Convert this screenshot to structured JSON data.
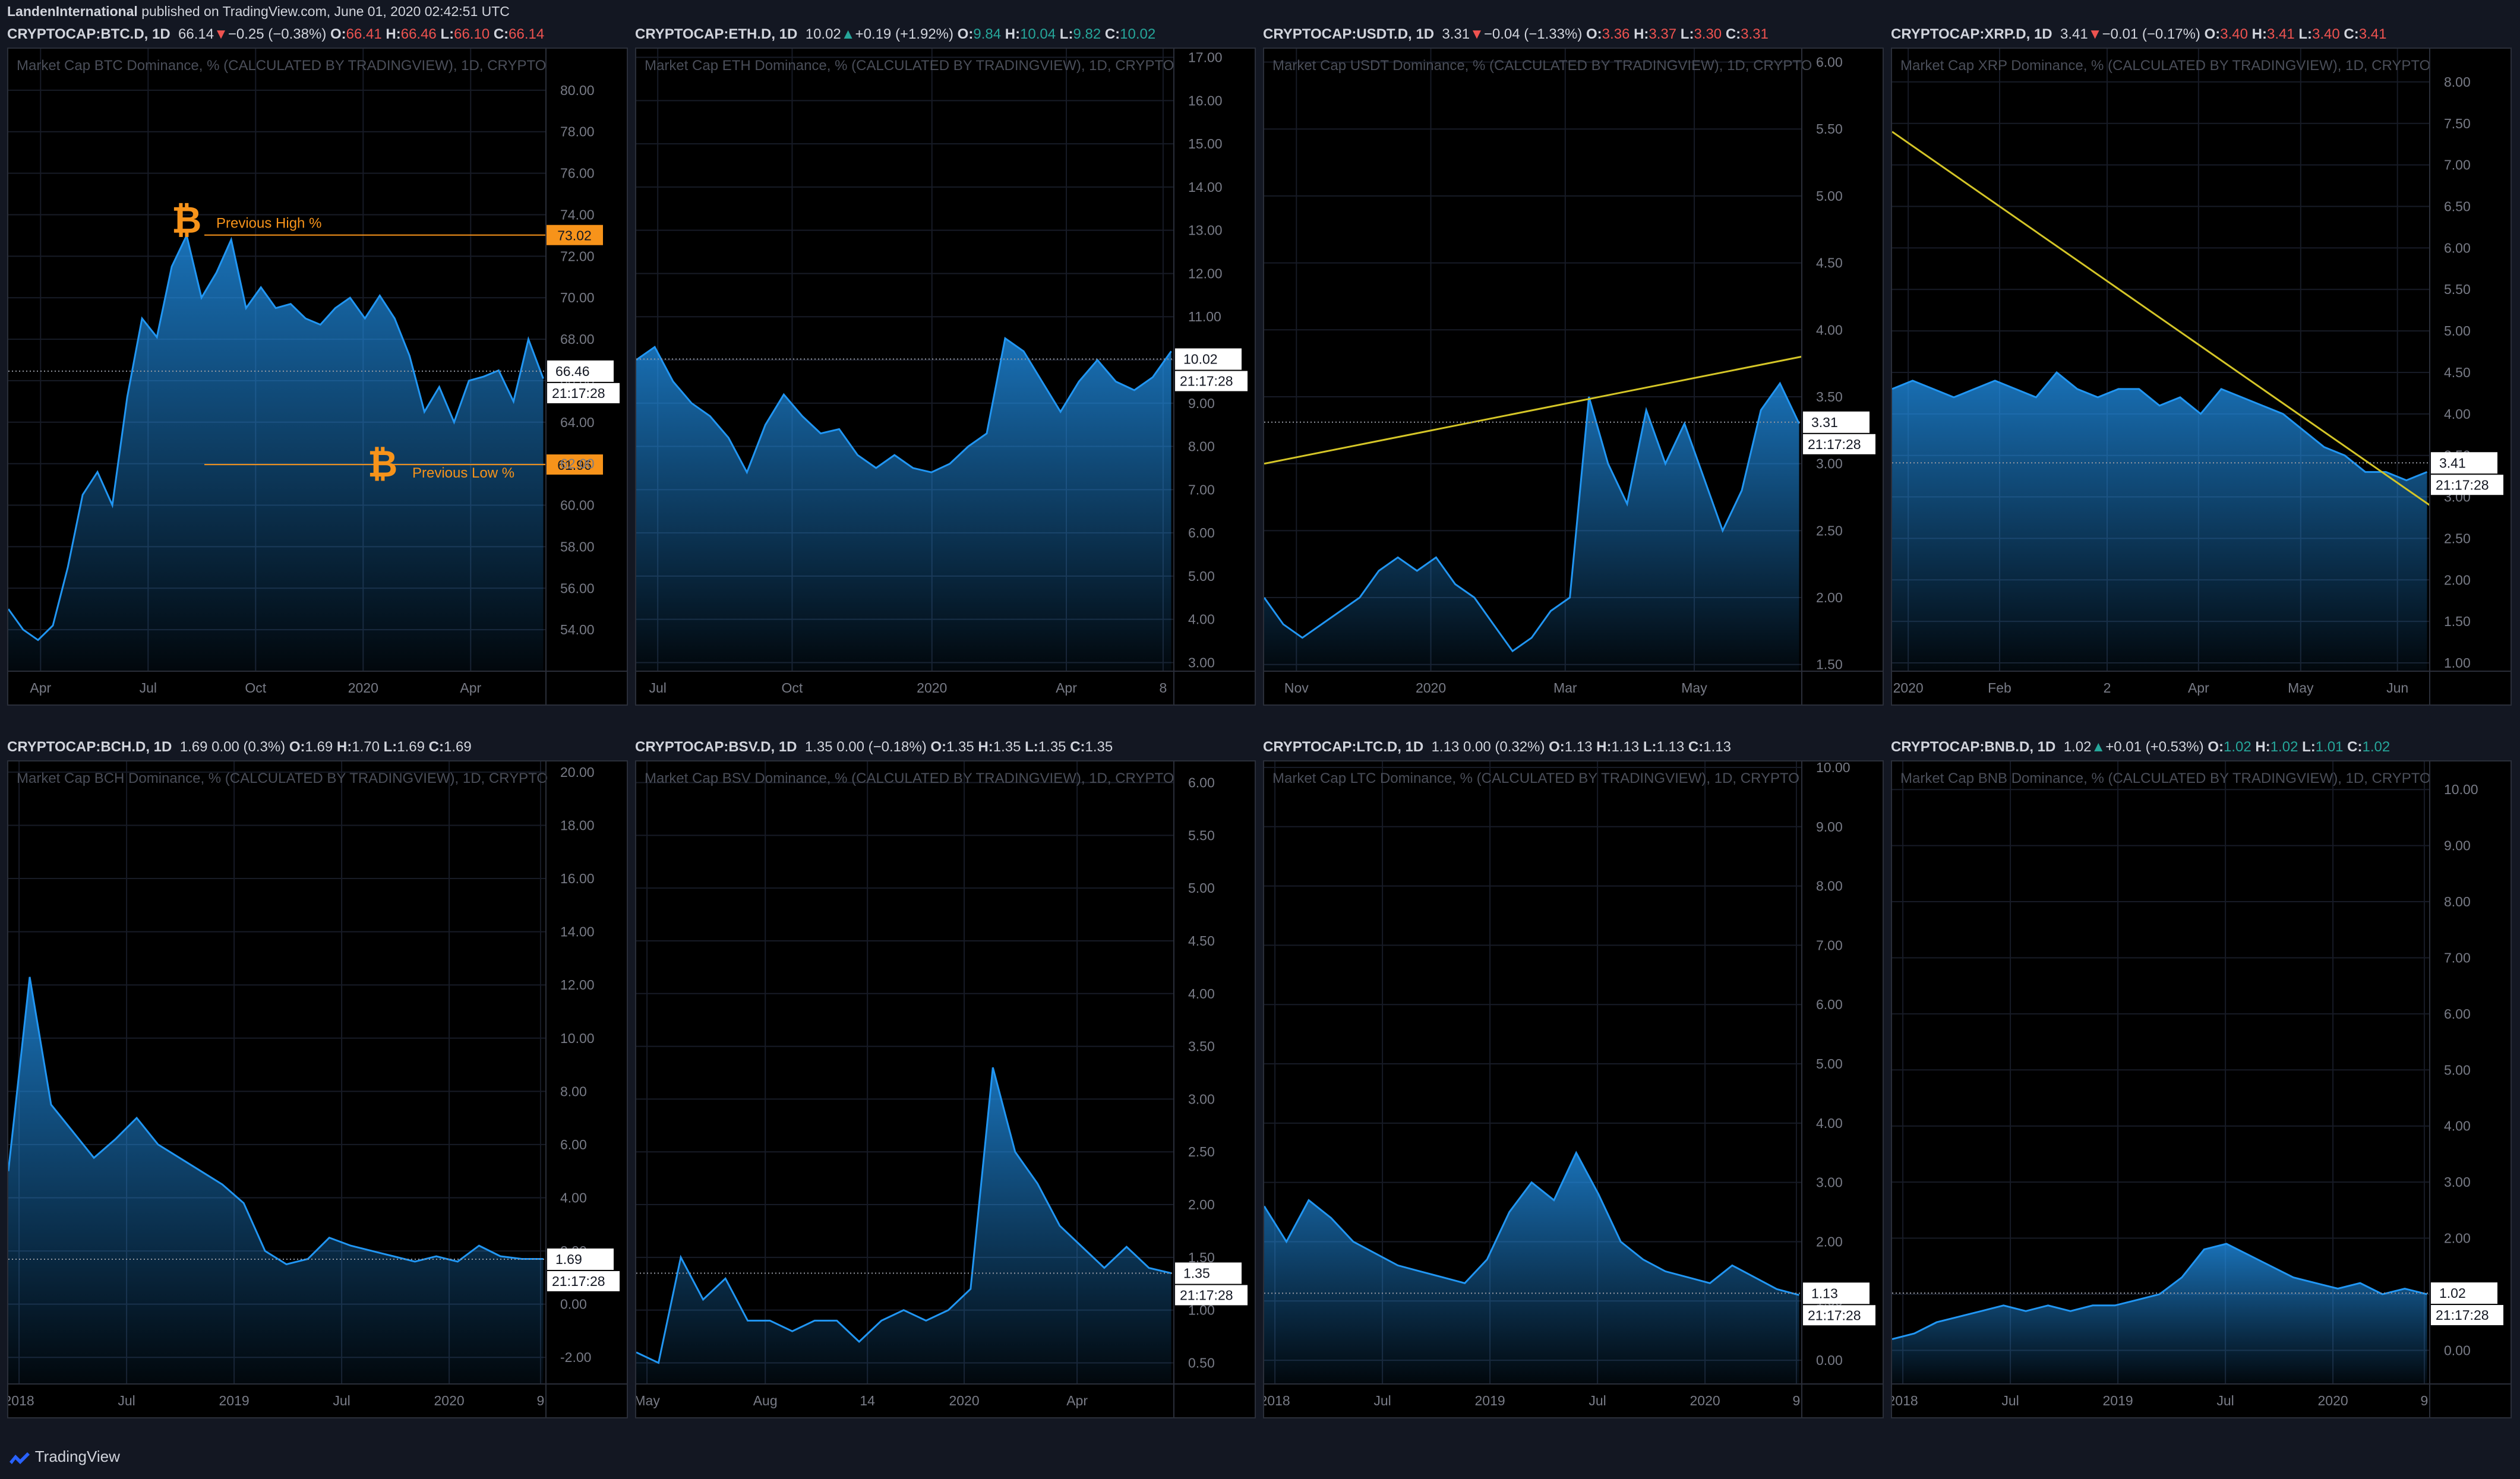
{
  "header": {
    "author": "LandenInternational",
    "published": "published on TradingView.com, June 01, 2020 02:42:51 UTC"
  },
  "brand": {
    "label": "TradingView",
    "accent": "#2962ff"
  },
  "countdown": "21:17:28",
  "colors": {
    "bg": "#131722",
    "chart_bg": "#000000",
    "line": "#2196f3",
    "axis_text": "#787b86",
    "down": "#ef5350",
    "up": "#26a69a",
    "trend": "#d4c527",
    "btc_marker": "#f7931a"
  },
  "panels": [
    {
      "symbol": "CRYPTOCAP:BTC.D, 1D",
      "last": "66.14",
      "dir": "down",
      "change": "−0.25 (−0.38%)",
      "O": "66.41",
      "H": "66.46",
      "L": "66.10",
      "C": "66.14",
      "ohlc_dir": "down",
      "watermark": "Market Cap BTC Dominance, % (CALCULATED BY TRADINGVIEW), 1D, CRYPTO",
      "price_label": "66.46"
    },
    {
      "symbol": "CRYPTOCAP:ETH.D, 1D",
      "last": "10.02",
      "dir": "up",
      "change": "+0.19 (+1.92%)",
      "O": "9.84",
      "H": "10.04",
      "L": "9.82",
      "C": "10.02",
      "ohlc_dir": "up",
      "watermark": "Market Cap ETH Dominance, % (CALCULATED BY TRADINGVIEW), 1D, CRYPTO",
      "price_label": "10.02"
    },
    {
      "symbol": "CRYPTOCAP:USDT.D, 1D",
      "last": "3.31",
      "dir": "down",
      "change": "−0.04 (−1.33%)",
      "O": "3.36",
      "H": "3.37",
      "L": "3.30",
      "C": "3.31",
      "ohlc_dir": "down",
      "watermark": "Market Cap USDT Dominance, % (CALCULATED BY TRADINGVIEW), 1D, CRYPTO",
      "price_label": "3.31"
    },
    {
      "symbol": "CRYPTOCAP:XRP.D, 1D",
      "last": "3.41",
      "dir": "down",
      "change": "−0.01 (−0.17%)",
      "O": "3.40",
      "H": "3.41",
      "L": "3.40",
      "C": "3.41",
      "ohlc_dir": "down",
      "watermark": "Market Cap XRP Dominance, % (CALCULATED BY TRADINGVIEW), 1D, CRYPTO",
      "price_label": "3.41"
    },
    {
      "symbol": "CRYPTOCAP:BCH.D, 1D",
      "last": "1.69",
      "dir": "none",
      "change": "0.00 (0.3%)",
      "O": "1.69",
      "H": "1.70",
      "L": "1.69",
      "C": "1.69",
      "ohlc_dir": "neutral",
      "watermark": "Market Cap BCH Dominance, % (CALCULATED BY TRADINGVIEW), 1D, CRYPTO",
      "price_label": "1.69"
    },
    {
      "symbol": "CRYPTOCAP:BSV.D, 1D",
      "last": "1.35",
      "dir": "none",
      "change": "0.00 (−0.18%)",
      "O": "1.35",
      "H": "1.35",
      "L": "1.35",
      "C": "1.35",
      "ohlc_dir": "neutral",
      "watermark": "Market Cap BSV Dominance, % (CALCULATED BY TRADINGVIEW), 1D, CRYPTO",
      "price_label": "1.35"
    },
    {
      "symbol": "CRYPTOCAP:LTC.D, 1D",
      "last": "1.13",
      "dir": "none",
      "change": "0.00 (0.32%)",
      "O": "1.13",
      "H": "1.13",
      "L": "1.13",
      "C": "1.13",
      "ohlc_dir": "neutral",
      "watermark": "Market Cap LTC Dominance, % (CALCULATED BY TRADINGVIEW), 1D, CRYPTO",
      "price_label": "1.13"
    },
    {
      "symbol": "CRYPTOCAP:BNB.D, 1D",
      "last": "1.02",
      "dir": "up",
      "change": "+0.01 (+0.53%)",
      "O": "1.02",
      "H": "1.02",
      "L": "1.01",
      "C": "1.02",
      "ohlc_dir": "up",
      "watermark": "Market Cap BNB Dominance, % (CALCULATED BY TRADINGVIEW), 1D, CRYPTO",
      "price_label": "1.02"
    }
  ],
  "chart_data": [
    {
      "type": "area",
      "title": "Market Cap BTC Dominance, % (CALCULATED BY TRADINGVIEW), 1D, CRYPTO",
      "ylim": [
        52,
        82
      ],
      "y_ticks": [
        "54.00",
        "56.00",
        "58.00",
        "60.00",
        "62.00",
        "64.00",
        "66.00",
        "68.00",
        "70.00",
        "72.00",
        "74.00",
        "76.00",
        "78.00",
        "80.00"
      ],
      "x_ticks": [
        "Apr",
        "Jul",
        "Oct",
        "2020",
        "Apr"
      ],
      "x_tick_pos": [
        0.06,
        0.26,
        0.46,
        0.66,
        0.86
      ],
      "y": [
        55.0,
        54.0,
        53.5,
        54.2,
        57.0,
        60.5,
        61.6,
        60.0,
        65.2,
        69.0,
        68.1,
        71.5,
        73.0,
        70.0,
        71.2,
        72.8,
        69.5,
        70.5,
        69.5,
        69.7,
        69.0,
        68.7,
        69.5,
        70.0,
        69.0,
        70.1,
        69.0,
        67.2,
        64.5,
        65.7,
        64.0,
        66.0,
        66.2,
        66.5,
        65.0,
        68.0,
        66.1
      ],
      "hlines": [
        {
          "label": "Previous High %",
          "value": 73.02,
          "tag": "73.02",
          "color": "#f7931a",
          "icon": "₿"
        },
        {
          "label": "Previous Low %",
          "value": 61.96,
          "tag": "61.96",
          "color": "#f7931a",
          "icon": "₿"
        }
      ],
      "last": 66.46
    },
    {
      "type": "area",
      "title": "Market Cap ETH Dominance, % (CALCULATED BY TRADINGVIEW), 1D, CRYPTO",
      "ylim": [
        2.8,
        17.2
      ],
      "y_ticks": [
        "3.00",
        "4.00",
        "5.00",
        "6.00",
        "7.00",
        "8.00",
        "9.00",
        "10.00",
        "11.00",
        "12.00",
        "13.00",
        "14.00",
        "15.00",
        "16.00",
        "17.00"
      ],
      "x_ticks": [
        "Jul",
        "Oct",
        "2020",
        "Apr",
        "8"
      ],
      "x_tick_pos": [
        0.04,
        0.29,
        0.55,
        0.8,
        0.98
      ],
      "y": [
        10.0,
        10.3,
        9.5,
        9.0,
        8.7,
        8.2,
        7.4,
        8.5,
        9.2,
        8.7,
        8.3,
        8.4,
        7.8,
        7.5,
        7.8,
        7.5,
        7.4,
        7.6,
        8.0,
        8.3,
        10.5,
        10.2,
        9.5,
        8.8,
        9.5,
        10.0,
        9.5,
        9.3,
        9.6,
        10.2
      ],
      "last": 10.02
    },
    {
      "type": "area",
      "title": "Market Cap USDT Dominance, % (CALCULATED BY TRADINGVIEW), 1D, CRYPTO",
      "ylim": [
        1.45,
        6.1
      ],
      "y_ticks": [
        "1.50",
        "2.00",
        "2.50",
        "3.00",
        "3.50",
        "4.00",
        "4.50",
        "5.00",
        "5.50",
        "6.00"
      ],
      "x_ticks": [
        "Nov",
        "2020",
        "Mar",
        "May"
      ],
      "x_tick_pos": [
        0.06,
        0.31,
        0.56,
        0.8
      ],
      "y": [
        2.0,
        1.8,
        1.7,
        1.8,
        1.9,
        2.0,
        2.2,
        2.3,
        2.2,
        2.3,
        2.1,
        2.0,
        1.8,
        1.6,
        1.7,
        1.9,
        2.0,
        3.5,
        3.0,
        2.7,
        3.4,
        3.0,
        3.3,
        2.9,
        2.5,
        2.8,
        3.4,
        3.6,
        3.3
      ],
      "trendline": {
        "y_start": 3.0,
        "y_end": 3.8,
        "color": "#d4c527"
      },
      "last": 3.31
    },
    {
      "type": "area",
      "title": "Market Cap XRP Dominance, % (CALCULATED BY TRADINGVIEW), 1D, CRYPTO",
      "ylim": [
        0.9,
        8.4
      ],
      "y_ticks": [
        "1.00",
        "1.50",
        "2.00",
        "2.50",
        "3.00",
        "3.50",
        "4.00",
        "4.50",
        "5.00",
        "5.50",
        "6.00",
        "6.50",
        "7.00",
        "7.50",
        "8.00"
      ],
      "x_ticks": [
        "2020",
        "Feb",
        "2",
        "Apr",
        "May",
        "Jun"
      ],
      "x_tick_pos": [
        0.03,
        0.2,
        0.4,
        0.57,
        0.76,
        0.94
      ],
      "y": [
        4.3,
        4.4,
        4.3,
        4.2,
        4.3,
        4.4,
        4.3,
        4.2,
        4.5,
        4.3,
        4.2,
        4.3,
        4.3,
        4.1,
        4.2,
        4.0,
        4.3,
        4.2,
        4.1,
        4.0,
        3.8,
        3.6,
        3.5,
        3.3,
        3.3,
        3.2,
        3.3
      ],
      "trendline": {
        "y_start": 7.4,
        "y_end": 2.9,
        "color": "#d4c527"
      },
      "last": 3.41
    },
    {
      "type": "area",
      "title": "Market Cap BCH Dominance, % (CALCULATED BY TRADINGVIEW), 1D, CRYPTO",
      "ylim": [
        -3.0,
        20.4
      ],
      "y_ticks": [
        "-2.00",
        "0.00",
        "2.00",
        "4.00",
        "6.00",
        "8.00",
        "10.00",
        "12.00",
        "14.00",
        "16.00",
        "18.00",
        "20.00"
      ],
      "x_ticks": [
        "2018",
        "Jul",
        "2019",
        "Jul",
        "2020",
        "9"
      ],
      "x_tick_pos": [
        0.02,
        0.22,
        0.42,
        0.62,
        0.82,
        0.99
      ],
      "y": [
        5.0,
        12.3,
        7.5,
        6.5,
        5.5,
        6.2,
        7.0,
        6.0,
        5.5,
        5.0,
        4.5,
        3.8,
        2.0,
        1.5,
        1.7,
        2.5,
        2.2,
        2.0,
        1.8,
        1.6,
        1.8,
        1.6,
        2.2,
        1.8,
        1.7,
        1.7
      ],
      "last": 1.69
    },
    {
      "type": "area",
      "title": "Market Cap BSV Dominance, % (CALCULATED BY TRADINGVIEW), 1D, CRYPTO",
      "ylim": [
        0.3,
        6.2
      ],
      "y_ticks": [
        "0.50",
        "1.00",
        "1.50",
        "2.00",
        "2.50",
        "3.00",
        "3.50",
        "4.00",
        "4.50",
        "5.00",
        "5.50",
        "6.00"
      ],
      "x_ticks": [
        "May",
        "Aug",
        "14",
        "2020",
        "Apr"
      ],
      "x_tick_pos": [
        0.02,
        0.24,
        0.43,
        0.61,
        0.82
      ],
      "y": [
        0.6,
        0.5,
        1.5,
        1.1,
        1.3,
        0.9,
        0.9,
        0.8,
        0.9,
        0.9,
        0.7,
        0.9,
        1.0,
        0.9,
        1.0,
        1.2,
        3.3,
        2.5,
        2.2,
        1.8,
        1.6,
        1.4,
        1.6,
        1.4,
        1.35
      ],
      "last": 1.35
    },
    {
      "type": "area",
      "title": "Market Cap LTC Dominance, % (CALCULATED BY TRADINGVIEW), 1D, CRYPTO",
      "ylim": [
        -0.4,
        10.1
      ],
      "y_ticks": [
        "0.00",
        "1.00",
        "2.00",
        "3.00",
        "4.00",
        "5.00",
        "6.00",
        "7.00",
        "8.00",
        "9.00",
        "10.00"
      ],
      "x_ticks": [
        "2018",
        "Jul",
        "2019",
        "Jul",
        "2020",
        "9"
      ],
      "x_tick_pos": [
        0.02,
        0.22,
        0.42,
        0.62,
        0.82,
        0.99
      ],
      "y": [
        2.6,
        2.0,
        2.7,
        2.4,
        2.0,
        1.8,
        1.6,
        1.5,
        1.4,
        1.3,
        1.7,
        2.5,
        3.0,
        2.7,
        3.5,
        2.8,
        2.0,
        1.7,
        1.5,
        1.4,
        1.3,
        1.6,
        1.4,
        1.2,
        1.1
      ],
      "last": 1.13
    },
    {
      "type": "area",
      "title": "Market Cap BNB Dominance, % (CALCULATED BY TRADINGVIEW), 1D, CRYPTO",
      "ylim": [
        -0.6,
        10.5
      ],
      "y_ticks": [
        "0.00",
        "1.00",
        "2.00",
        "3.00",
        "4.00",
        "5.00",
        "6.00",
        "7.00",
        "8.00",
        "9.00",
        "10.00"
      ],
      "x_ticks": [
        "2018",
        "Jul",
        "2019",
        "Jul",
        "2020",
        "9"
      ],
      "x_tick_pos": [
        0.02,
        0.22,
        0.42,
        0.62,
        0.82,
        0.99
      ],
      "y": [
        0.2,
        0.3,
        0.5,
        0.6,
        0.7,
        0.8,
        0.7,
        0.8,
        0.7,
        0.8,
        0.8,
        0.9,
        1.0,
        1.3,
        1.8,
        1.9,
        1.7,
        1.5,
        1.3,
        1.2,
        1.1,
        1.2,
        1.0,
        1.1,
        1.0
      ],
      "last": 1.02
    }
  ]
}
